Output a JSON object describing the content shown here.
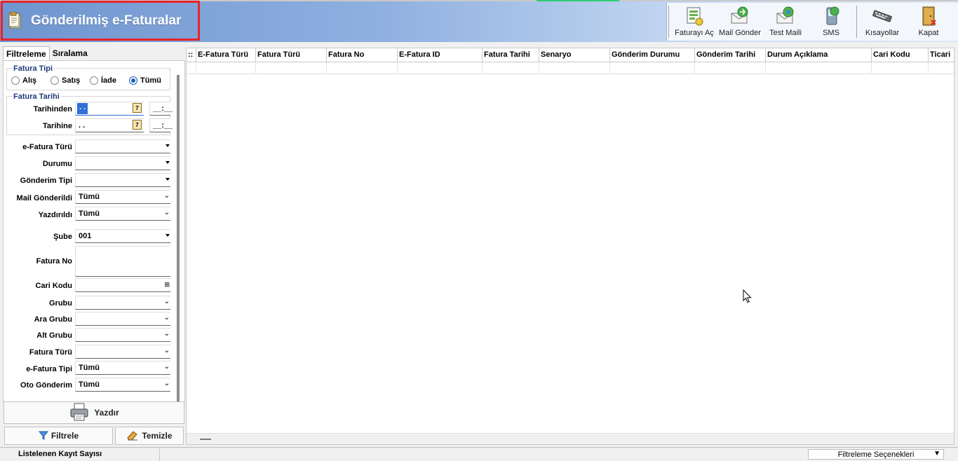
{
  "window": {
    "title": "Gönderilmiş e-Faturalar"
  },
  "toolbar": {
    "items": [
      {
        "label": "Faturayı Aç",
        "icon": "invoice-open-icon"
      },
      {
        "label": "Mail Gönder",
        "icon": "mail-send-icon"
      },
      {
        "label": "Test Maili",
        "icon": "test-mail-icon"
      },
      {
        "label": "SMS",
        "icon": "sms-icon"
      },
      {
        "label": "Kısayollar",
        "icon": "keyboard-icon"
      },
      {
        "label": "Kapat",
        "icon": "close-door-icon"
      }
    ]
  },
  "tabs": {
    "filter": "Filtreleme",
    "sort": "Sıralama"
  },
  "filter": {
    "fatura_tipi": {
      "title": "Fatura Tipi",
      "options": [
        "Alış",
        "Satış",
        "İade",
        "Tümü"
      ],
      "selected": "Tümü"
    },
    "fatura_tarihi": {
      "title": "Fatura Tarihi",
      "from_label": "Tarihinden",
      "from_value": " . .",
      "to_label": "Tarihine",
      "to_value": " . .",
      "time_value": "__:__",
      "cal_day": "7"
    },
    "fields": {
      "efatura_turu": {
        "label": "e-Fatura Türü",
        "value": ""
      },
      "durumu": {
        "label": "Durumu",
        "value": ""
      },
      "gonderim_tipi": {
        "label": "Gönderim Tipi",
        "value": ""
      },
      "mail_gonderildi": {
        "label": "Mail Gönderildi",
        "value": "Tümü"
      },
      "yazdirildi": {
        "label": "Yazdırıldı",
        "value": "Tümü"
      },
      "sube": {
        "label": "Şube",
        "value": "001"
      },
      "fatura_no": {
        "label": "Fatura No",
        "value": ""
      },
      "cari_kodu": {
        "label": "Cari Kodu",
        "value": ""
      },
      "grubu": {
        "label": "Grubu",
        "value": ""
      },
      "ara_grubu": {
        "label": "Ara Grubu",
        "value": ""
      },
      "alt_grubu": {
        "label": "Alt Grubu",
        "value": ""
      },
      "fatura_turu": {
        "label": "Fatura Türü",
        "value": ""
      },
      "efatura_tipi": {
        "label": "e-Fatura Tipi",
        "value": "Tümü"
      },
      "oto_gonderim": {
        "label": "Oto Gönderim",
        "value": "Tümü"
      }
    }
  },
  "buttons": {
    "print": "Yazdır",
    "filter": "Filtrele",
    "clear": "Temizle"
  },
  "grid": {
    "row_handle": "::",
    "columns": [
      "E-Fatura Türü",
      "Fatura Türü",
      "Fatura No",
      "E-Fatura ID",
      "Fatura Tarihi",
      "Senaryo",
      "Gönderim Durumu",
      "Gönderim Tarihi",
      "Durum Açıklama",
      "Cari Kodu",
      "Ticari"
    ]
  },
  "status": {
    "count_label": "Listelenen Kayıt Sayısı",
    "options_label": "Filtreleme Seçenekleri"
  }
}
